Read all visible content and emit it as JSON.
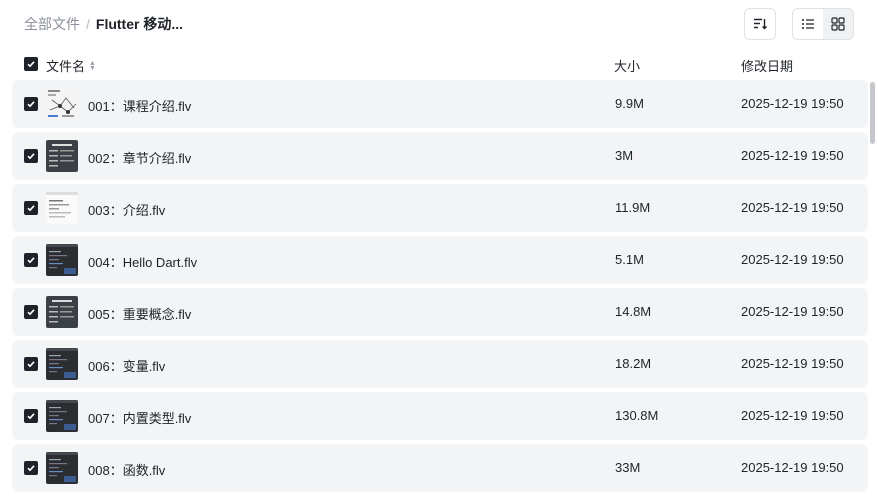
{
  "breadcrumb": {
    "root": "全部文件",
    "separator": "/",
    "current": "Flutter 移动..."
  },
  "toolbar": {
    "sort_icon": "sort-list-icon",
    "list_view_icon": "list-view-icon",
    "grid_view_icon": "grid-view-icon",
    "active_view": "list"
  },
  "columns": {
    "name": "文件名",
    "size": "大小",
    "date": "修改日期"
  },
  "colors": {
    "checkbox": "#1f2329",
    "row_bg": "#f3f4f6"
  },
  "files": [
    {
      "name": "001：课程介绍.flv",
      "size": "9.9M",
      "date": "2025-12-19 19:50",
      "checked": true,
      "thumb": "light-diagram"
    },
    {
      "name": "002：章节介绍.flv",
      "size": "3M",
      "date": "2025-12-19 19:50",
      "checked": true,
      "thumb": "dark-slide"
    },
    {
      "name": "003：介绍.flv",
      "size": "11.9M",
      "date": "2025-12-19 19:50",
      "checked": true,
      "thumb": "light-doc"
    },
    {
      "name": "004：Hello Dart.flv",
      "size": "5.1M",
      "date": "2025-12-19 19:50",
      "checked": true,
      "thumb": "dark-code"
    },
    {
      "name": "005：重要概念.flv",
      "size": "14.8M",
      "date": "2025-12-19 19:50",
      "checked": true,
      "thumb": "dark-slide"
    },
    {
      "name": "006：变量.flv",
      "size": "18.2M",
      "date": "2025-12-19 19:50",
      "checked": true,
      "thumb": "dark-code"
    },
    {
      "name": "007：内置类型.flv",
      "size": "130.8M",
      "date": "2025-12-19 19:50",
      "checked": true,
      "thumb": "dark-code"
    },
    {
      "name": "008：函数.flv",
      "size": "33M",
      "date": "2025-12-19 19:50",
      "checked": true,
      "thumb": "dark-code"
    }
  ]
}
